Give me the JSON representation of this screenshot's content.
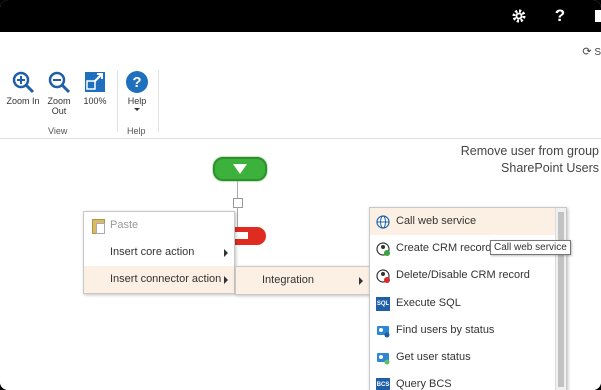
{
  "topbar": {
    "settings_icon": "gear-icon",
    "help_icon": "question-icon",
    "help_label": "?"
  },
  "cmdbar": {
    "sync_label": "S",
    "sync_icon": "sync-icon"
  },
  "ribbon": {
    "view_group": "View",
    "help_group": "Help",
    "zoom_in": "Zoom In",
    "zoom_out": "Zoom Out",
    "zoom_100": "100%",
    "help": "Help"
  },
  "canvas": {
    "title_line1": "Remove user from group",
    "title_line2": "SharePoint Users"
  },
  "context_menu": {
    "items": [
      {
        "label": "Paste",
        "icon": "paste-icon",
        "disabled": true
      },
      {
        "label": "Insert core action",
        "submenu": true
      },
      {
        "label": "Insert connector action",
        "submenu": true,
        "highlighted": true
      }
    ]
  },
  "submenu": {
    "items": [
      {
        "label": "Integration",
        "submenu": true,
        "highlighted": true
      }
    ]
  },
  "actions_menu": {
    "items": [
      {
        "label": "Call web service",
        "icon": "globe-icon",
        "highlighted": true
      },
      {
        "label": "Create CRM record",
        "icon": "crm-create-icon"
      },
      {
        "label": "Delete/Disable CRM record",
        "icon": "crm-delete-icon"
      },
      {
        "label": "Execute SQL",
        "icon": "sql-icon",
        "icon_text": "SQL"
      },
      {
        "label": "Find users by status",
        "icon": "find-users-icon"
      },
      {
        "label": "Get user status",
        "icon": "user-status-icon"
      },
      {
        "label": "Query BCS",
        "icon": "bcs-icon",
        "icon_text": "BCS"
      }
    ]
  },
  "tooltip": "Call web service"
}
